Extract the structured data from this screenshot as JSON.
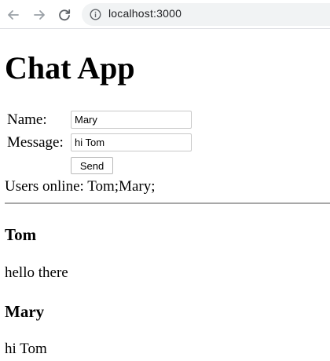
{
  "browser": {
    "url": "localhost:3000",
    "icons": {
      "back": "arrow-left-icon",
      "forward": "arrow-right-icon",
      "reload": "reload-icon",
      "site_info": "info-circle-icon"
    }
  },
  "page": {
    "title": "Chat App"
  },
  "form": {
    "name_label": "Name:",
    "name_value": "Mary",
    "message_label": "Message:",
    "message_value": "hi Tom",
    "send_label": "Send"
  },
  "online": {
    "label": "Users online:",
    "users": "Tom;Mary;"
  },
  "messages": [
    {
      "author": "Tom",
      "text": "hello there"
    },
    {
      "author": "Mary",
      "text": "hi Tom"
    }
  ]
}
